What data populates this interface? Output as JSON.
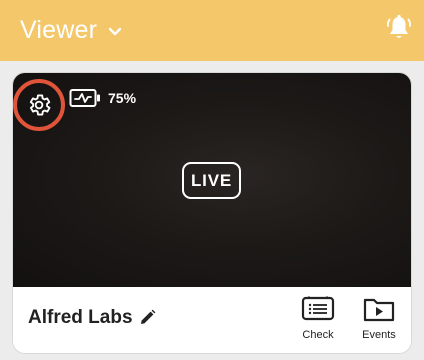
{
  "header": {
    "title": "Viewer",
    "background_color": "#f4c76a",
    "dropdown_icon": "chevron-down-icon",
    "notification_icon": "bell-ringing-icon"
  },
  "camera_card": {
    "status_badge": "LIVE",
    "battery_level": "75%",
    "battery_icon": "battery-charging-icon",
    "settings_icon": "gear-icon",
    "settings_highlight_color": "#e0553a",
    "camera_name": "Alfred Labs",
    "edit_icon": "pencil-icon",
    "actions": [
      {
        "label": "Check",
        "icon": "checklist-icon"
      },
      {
        "label": "Events",
        "icon": "folder-play-icon"
      }
    ]
  }
}
